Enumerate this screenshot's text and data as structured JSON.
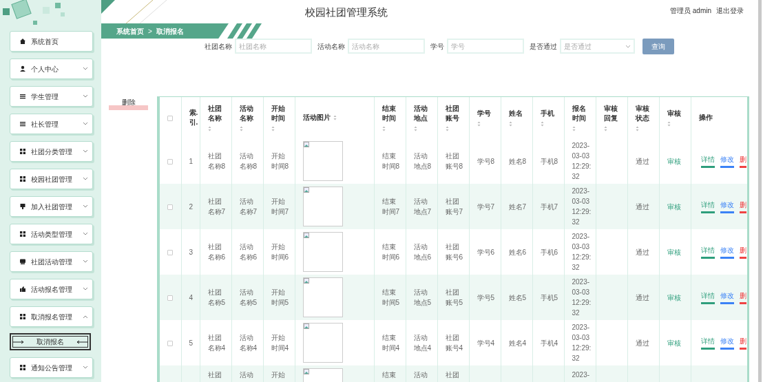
{
  "header": {
    "title": "校园社团管理系统",
    "user": "管理员 admin",
    "logout": "退出登录"
  },
  "breadcrumb": {
    "items": [
      "系统首页",
      "取消报名"
    ],
    "separator": ">"
  },
  "sidebar": {
    "items": [
      {
        "label": "系统首页",
        "kind": "home"
      },
      {
        "label": "个人中心",
        "kind": "user",
        "expanded": false
      },
      {
        "label": "学生管理",
        "kind": "list",
        "expanded": false
      },
      {
        "label": "社长管理",
        "kind": "list",
        "expanded": false
      },
      {
        "label": "社团分类管理",
        "kind": "grid",
        "expanded": false
      },
      {
        "label": "校园社团管理",
        "kind": "grid",
        "expanded": false
      },
      {
        "label": "加入社团管理",
        "kind": "flag",
        "expanded": false
      },
      {
        "label": "活动类型管理",
        "kind": "grid",
        "expanded": false
      },
      {
        "label": "社团活动管理",
        "kind": "monitor",
        "expanded": false
      },
      {
        "label": "活动报名管理",
        "kind": "thumb",
        "expanded": false
      },
      {
        "label": "取消报名管理",
        "kind": "grid",
        "expanded": true,
        "children": [
          {
            "label": "取消报名",
            "selected": true
          }
        ]
      },
      {
        "label": "通知公告管理",
        "kind": "grid",
        "expanded": false
      }
    ]
  },
  "search": {
    "fields": [
      {
        "label": "社团名称",
        "placeholder": "社团名称",
        "kind": "text"
      },
      {
        "label": "活动名称",
        "placeholder": "活动名称",
        "kind": "text"
      },
      {
        "label": "学号",
        "placeholder": "学号",
        "kind": "text"
      },
      {
        "label": "是否通过",
        "placeholder": "是否通过",
        "kind": "select"
      }
    ],
    "button": "查询"
  },
  "delete_button": "删除",
  "table": {
    "select_all_checked": false,
    "columns": [
      {
        "label": "索.引.",
        "sortable": false
      },
      {
        "label": "社团名称",
        "sortable": true
      },
      {
        "label": "活动名称",
        "sortable": true
      },
      {
        "label": "开始时间",
        "sortable": true
      },
      {
        "label": "活动图片",
        "sortable": true
      },
      {
        "label": "结束时间",
        "sortable": true
      },
      {
        "label": "活动地点",
        "sortable": true
      },
      {
        "label": "社团账号",
        "sortable": true
      },
      {
        "label": "学号",
        "sortable": true
      },
      {
        "label": "姓名",
        "sortable": true
      },
      {
        "label": "手机",
        "sortable": true
      },
      {
        "label": "报名时间",
        "sortable": true
      },
      {
        "label": "审核回复",
        "sortable": true
      },
      {
        "label": "审核状态",
        "sortable": true
      },
      {
        "label": "审核",
        "sortable": true
      },
      {
        "label": "操作",
        "sortable": false
      }
    ],
    "rows": [
      {
        "checked": false,
        "cells": [
          "1",
          "社团名称8",
          "活动名称8",
          "开始时间8",
          null,
          "结束时间8",
          "活动地点8",
          "社团账号8",
          "学号8",
          "姓名8",
          "手机8",
          "2023-03-03 12:29:32",
          null,
          "通过",
          "审核"
        ],
        "actions": [
          {
            "label": "详情",
            "color": "#2e9e7c"
          },
          {
            "label": "修改",
            "color": "#3b82f6"
          },
          {
            "label": "删",
            "color": "#ef4444"
          }
        ]
      },
      {
        "checked": false,
        "cells": [
          "2",
          "社团名称7",
          "活动名称7",
          "开始时间7",
          null,
          "结束时间7",
          "活动地点7",
          "社团账号7",
          "学号7",
          "姓名7",
          "手机7",
          "2023-03-03 12:29:32",
          null,
          "通过",
          "审核"
        ],
        "actions": [
          {
            "label": "详情",
            "color": "#2e9e7c"
          },
          {
            "label": "修改",
            "color": "#3b82f6"
          },
          {
            "label": "删",
            "color": "#ef4444"
          }
        ]
      },
      {
        "checked": false,
        "cells": [
          "3",
          "社团名称6",
          "活动名称6",
          "开始时间6",
          null,
          "结束时间6",
          "活动地点6",
          "社团账号6",
          "学号6",
          "姓名6",
          "手机6",
          "2023-03-03 12:29:32",
          null,
          "通过",
          "审核"
        ],
        "actions": [
          {
            "label": "详情",
            "color": "#2e9e7c"
          },
          {
            "label": "修改",
            "color": "#3b82f6"
          },
          {
            "label": "删",
            "color": "#ef4444"
          }
        ]
      },
      {
        "checked": false,
        "cells": [
          "4",
          "社团名称5",
          "活动名称5",
          "开始时间5",
          null,
          "结束时间5",
          "活动地点5",
          "社团账号5",
          "学号5",
          "姓名5",
          "手机5",
          "2023-03-03 12:29:32",
          null,
          "通过",
          "审核"
        ],
        "actions": [
          {
            "label": "详情",
            "color": "#2e9e7c"
          },
          {
            "label": "修改",
            "color": "#3b82f6"
          },
          {
            "label": "删",
            "color": "#ef4444"
          }
        ]
      },
      {
        "checked": false,
        "cells": [
          "5",
          "社团名称4",
          "活动名称4",
          "开始时间4",
          null,
          "结束时间4",
          "活动地点4",
          "社团账号4",
          "学号4",
          "姓名4",
          "手机4",
          "2023-03-03 12:29:32",
          null,
          "通过",
          "审核"
        ],
        "actions": [
          {
            "label": "详情",
            "color": "#2e9e7c"
          },
          {
            "label": "修改",
            "color": "#3b82f6"
          },
          {
            "label": "删",
            "color": "#ef4444"
          }
        ]
      },
      {
        "cells": [
          null,
          "社团",
          "活动",
          "开始",
          null,
          "结束",
          "活动",
          "社团",
          null,
          null,
          null,
          "2023-",
          null,
          null,
          null
        ]
      }
    ]
  }
}
